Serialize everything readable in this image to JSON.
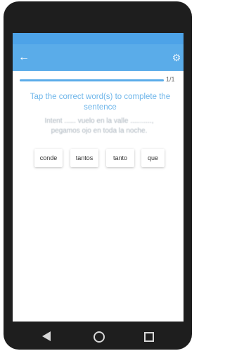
{
  "progress": {
    "label": "1/1",
    "value": 1.0
  },
  "prompt": "Tap the correct word(s) to complete the sentence",
  "sentence": {
    "line1": "Intent ...... vuelo en la valle ..........., ",
    "line2": "pegamos ojo en toda la noche."
  },
  "choices": [
    "conde",
    "tantos",
    "tanto",
    "que"
  ],
  "icons": {
    "back": "back-arrow-icon",
    "settings": "settings-icon",
    "nav_back": "triangle-back-icon",
    "nav_home": "circle-home-icon",
    "nav_recent": "square-recent-icon"
  },
  "colors": {
    "accent": "#5aace9",
    "prompt": "#6fb6ea"
  }
}
